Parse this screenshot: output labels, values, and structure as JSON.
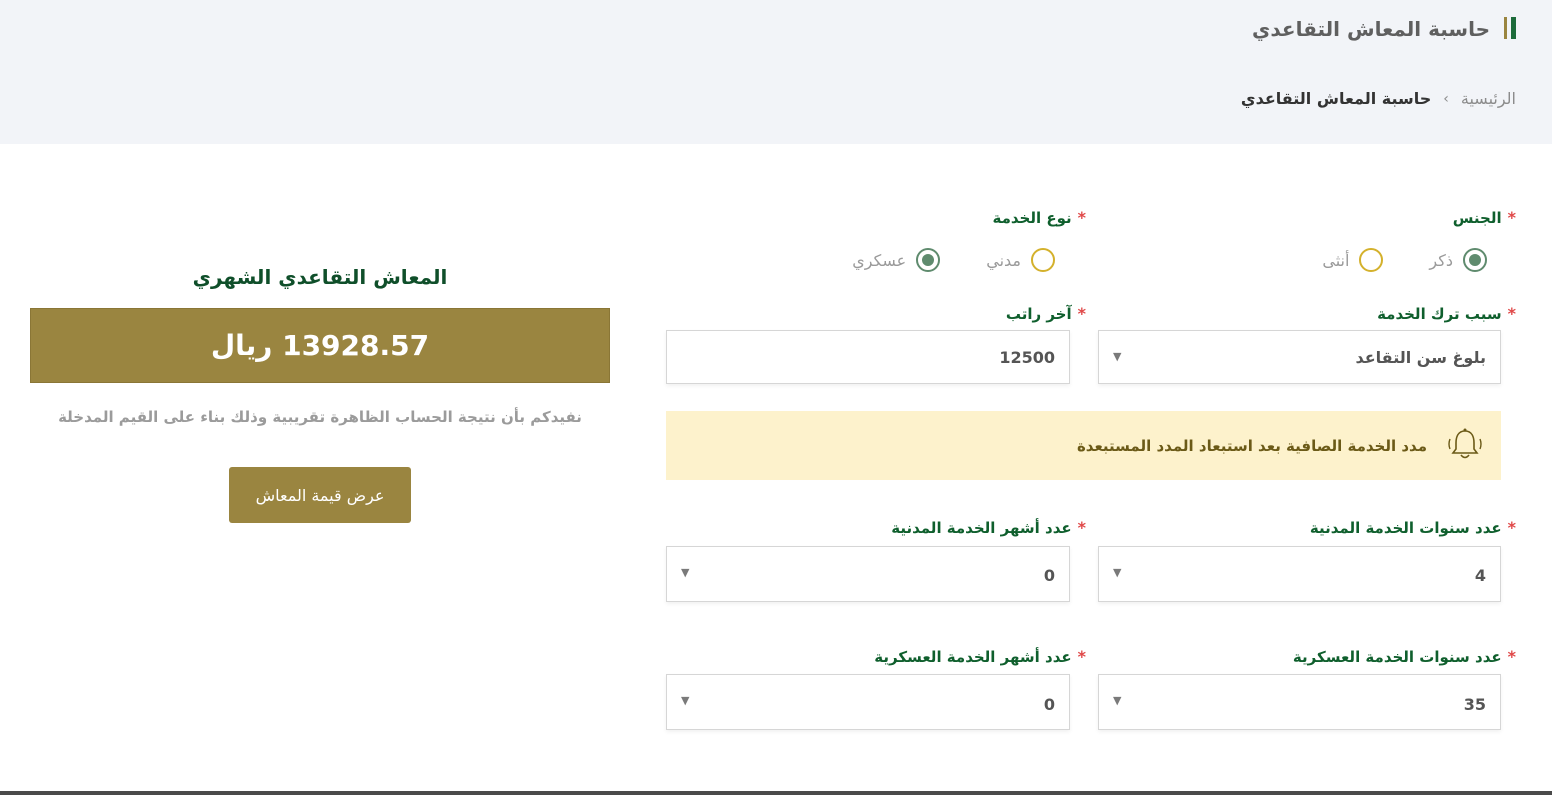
{
  "header": {
    "title": "حاسبة المعاش التقاعدي",
    "breadcrumb": {
      "home": "الرئيسية",
      "separator": "›",
      "current": "حاسبة المعاش التقاعدي"
    }
  },
  "form": {
    "required_mark": "*",
    "gender": {
      "label": "الجنس",
      "options": [
        {
          "label": "ذكر",
          "checked": true
        },
        {
          "label": "أنثى",
          "checked": false
        }
      ]
    },
    "service_type": {
      "label": "نوع الخدمة",
      "options": [
        {
          "label": "مدني",
          "checked": false
        },
        {
          "label": "عسكري",
          "checked": true
        }
      ]
    },
    "leave_reason": {
      "label": "سبب ترك الخدمة",
      "value": "بلوغ سن التقاعد"
    },
    "last_salary": {
      "label": "آخر راتب",
      "value": "12500"
    },
    "notice": {
      "text": "مدد الخدمة الصافية بعد استبعاد المدد المستبعدة",
      "icon": "bell-icon"
    },
    "civil_years": {
      "label": "عدد سنوات الخدمة المدنية",
      "value": "4"
    },
    "civil_months": {
      "label": "عدد أشهر الخدمة المدنية",
      "value": "0"
    },
    "military_years": {
      "label": "عدد سنوات الخدمة العسكرية",
      "value": "35"
    },
    "military_months": {
      "label": "عدد أشهر الخدمة العسكرية",
      "value": "0"
    }
  },
  "result": {
    "title": "المعاش التقاعدي الشهري",
    "amount": "13928.57 ريال",
    "note": "نفيدكم بأن نتيجة الحساب الظاهرة تقريبية وذلك بناء على القيم المدخلة",
    "button_label": "عرض قيمة المعاش"
  },
  "colors": {
    "brand_green": "#0f5f2d",
    "brand_gold": "#9a8540",
    "notice_bg": "#fdf2cc",
    "required": "#e04848"
  }
}
